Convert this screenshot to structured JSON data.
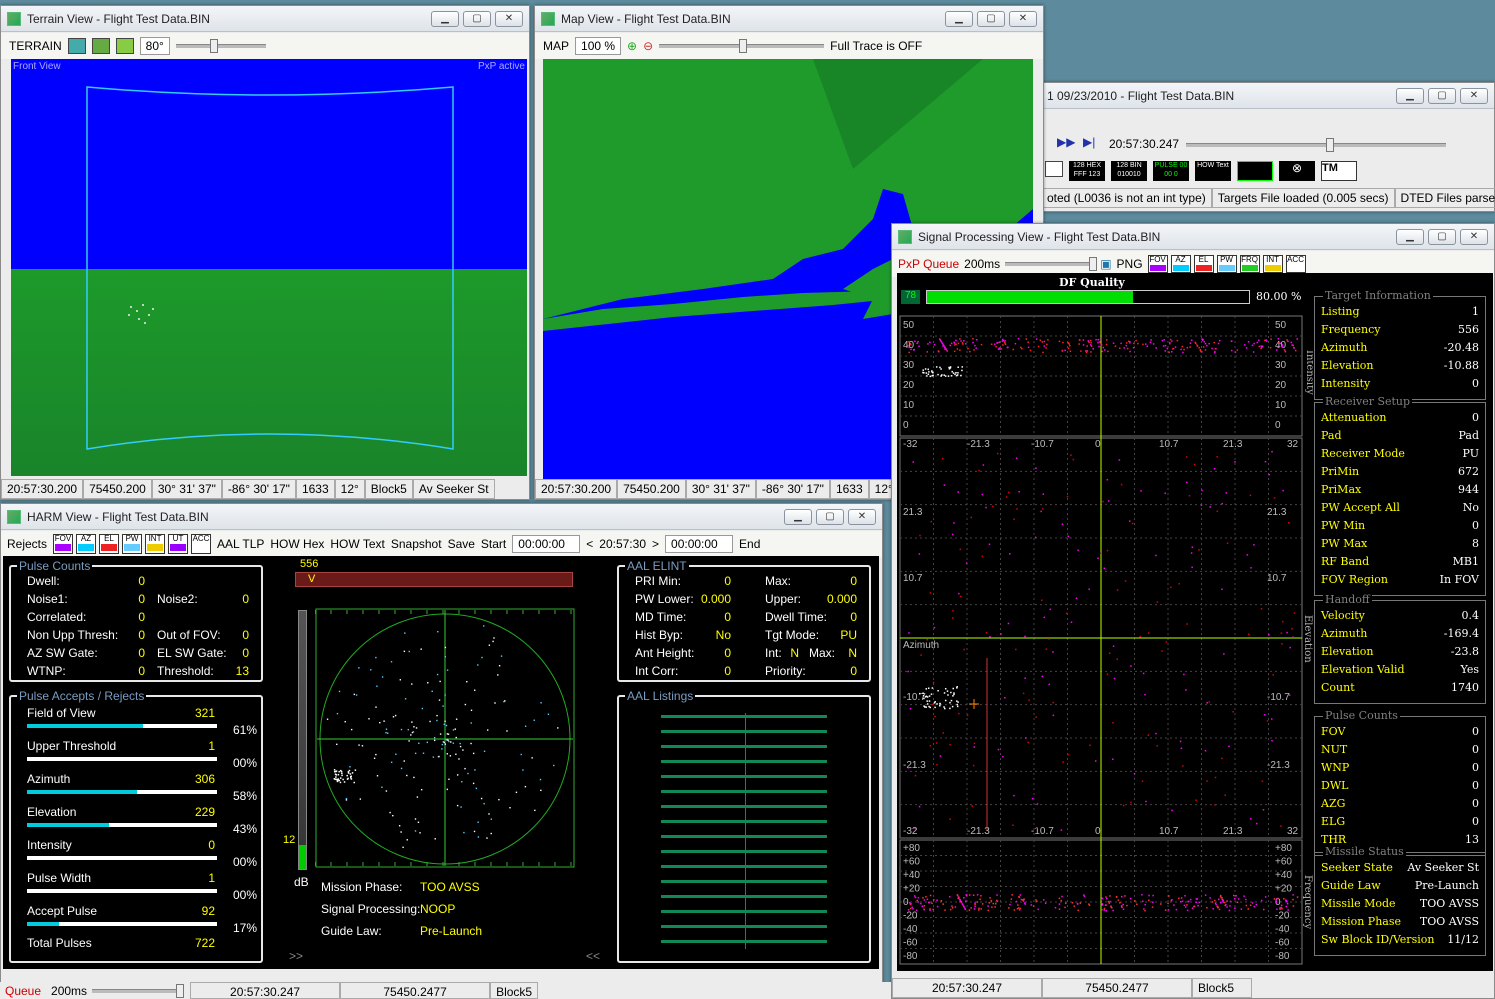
{
  "terrain": {
    "title": "Terrain View - Flight Test Data.BIN",
    "toolbar_label": "TERRAIN",
    "fov": "80°",
    "overlay_left": "Front View",
    "overlay_right": "PxP active",
    "status": [
      "20:57:30.200",
      "75450.200",
      "30° 31' 37\"",
      "-86° 30' 17\"",
      "1633",
      "12°",
      "Block5",
      "Av Seeker St"
    ]
  },
  "map": {
    "title": "Map View - Flight Test Data.BIN",
    "toolbar_label": "MAP",
    "zoom": "100 %",
    "trace": "Full Trace is OFF",
    "status": [
      "20:57:30.200",
      "75450.200",
      "30° 31' 37\"",
      "-86° 30' 17\"",
      "1633",
      "12°"
    ]
  },
  "player": {
    "title": "1 09/23/2010 - Flight Test Data.BIN",
    "time": "20:57:30.247",
    "buttons": [
      "128 HEX FFF 123",
      "128 BIN 010010",
      "PULSE 00 00 0",
      "HOW Text",
      "TM"
    ],
    "status": [
      "oted (L0036 is not an int type)",
      "Targets File loaded (0.005 secs)",
      "DTED Files parsed (..."
    ]
  },
  "signal": {
    "title": "Signal Processing View - Flight Test Data.BIN",
    "queue_label": "PxP Queue",
    "queue_ms": "200ms",
    "png": "PNG",
    "filters": [
      "FOV",
      "AZ",
      "EL",
      "PW",
      "FRQ",
      "INT",
      "ACC"
    ],
    "df_label": "DF Quality",
    "df_value": "78",
    "df_pct": "80.00 %",
    "df_fraction": 0.8,
    "intensity_ticks": [
      "50",
      "40",
      "30",
      "20",
      "10",
      "0"
    ],
    "intensity_label": "Intensity",
    "az_ticks": [
      "-32",
      "-21.3",
      "-10.7",
      "0",
      "10.7",
      "21.3",
      "32"
    ],
    "el_label": "Elevation",
    "az_label": "Azimuth",
    "el_ticks": [
      "21.3",
      "10.7",
      "-10.7",
      "-21.3"
    ],
    "freq_ticks": [
      "+80",
      "+60",
      "+40",
      "+20",
      "0",
      "-20",
      "-40",
      "-60",
      "-80"
    ],
    "freq_label": "Frequency",
    "sections": [
      {
        "title": "Target Information",
        "rows": [
          [
            "Listing",
            "1"
          ],
          [
            "Frequency",
            "556"
          ],
          [
            "Azimuth",
            "-20.48"
          ],
          [
            "Elevation",
            "-10.88"
          ],
          [
            "Intensity",
            "0"
          ]
        ]
      },
      {
        "title": "Receiver Setup",
        "rows": [
          [
            "Attenuation",
            "0"
          ],
          [
            "Pad",
            "Pad"
          ],
          [
            "Receiver Mode",
            "PU"
          ],
          [
            "PriMin",
            "672"
          ],
          [
            "PriMax",
            "944"
          ],
          [
            "PW Accept All",
            "No"
          ],
          [
            "PW Min",
            "0"
          ],
          [
            "PW Max",
            "8"
          ],
          [
            "RF Band",
            "MB1"
          ],
          [
            "FOV Region",
            "In  FOV"
          ]
        ]
      },
      {
        "title": "Handoff",
        "rows": [
          [
            "Velocity",
            "0.4"
          ],
          [
            "Azimuth",
            "-169.4"
          ],
          [
            "Elevation",
            "-23.8"
          ],
          [
            "Elevation Valid",
            "Yes"
          ],
          [
            "Count",
            "1740"
          ]
        ]
      },
      {
        "title": "Pulse Counts",
        "rows": [
          [
            "FOV",
            "0"
          ],
          [
            "NUT",
            "0"
          ],
          [
            "WNP",
            "0"
          ],
          [
            "DWL",
            "0"
          ],
          [
            "AZG",
            "0"
          ],
          [
            "ELG",
            "0"
          ],
          [
            "THR",
            "13"
          ]
        ]
      },
      {
        "title": "Missile Status",
        "rows": [
          [
            "Seeker State",
            "Av Seeker St"
          ],
          [
            "Guide Law",
            "Pre-Launch"
          ],
          [
            "Missile Mode",
            "TOO AVSS"
          ],
          [
            "Mission Phase",
            "TOO AVSS"
          ],
          [
            "Sw Block ID/Version",
            "11/12"
          ]
        ]
      }
    ],
    "status": [
      "20:57:30.247",
      "75450.2477",
      "Block5"
    ]
  },
  "harm": {
    "title": "HARM View - Flight Test Data.BIN",
    "toolbar": {
      "rejects": "Rejects",
      "filters": [
        "FOV",
        "AZ",
        "EL",
        "PW",
        "INT",
        "UT",
        "ACC"
      ],
      "aal_tlp": "AAL TLP",
      "how_hex": "HOW Hex",
      "how_text": "HOW Text",
      "snapshot": "Snapshot",
      "save": "Save",
      "start": "Start",
      "start_time": "00:00:00",
      "lt": "<",
      "cur": "20:57:30",
      "gt": ">",
      "end_time": "00:00:00",
      "end": "End"
    },
    "pulse_counts": {
      "title": "Pulse Counts",
      "rows": [
        {
          "l": "Dwell:",
          "v": "0"
        },
        {
          "l": "Noise1:",
          "v": "0",
          "l2": "Noise2:",
          "v2": "0"
        },
        {
          "l": "Correlated:",
          "v": "0"
        },
        {
          "l": "Non Upp Thresh:",
          "v": "0",
          "l2": "Out of FOV:",
          "v2": "0"
        },
        {
          "l": "AZ SW Gate:",
          "v": "0",
          "l2": "EL SW Gate:",
          "v2": "0"
        },
        {
          "l": "WTNP:",
          "v": "0",
          "l2": "Threshold:",
          "v2": "13"
        }
      ]
    },
    "accepts": {
      "title": "Pulse Accepts / Rejects",
      "rows": [
        {
          "l": "Field of View",
          "v": "321",
          "pct": "61%",
          "f": 0.61
        },
        {
          "l": "Upper Threshold",
          "v": "1",
          "pct": "00%",
          "f": 0.0
        },
        {
          "l": "Azimuth",
          "v": "306",
          "pct": "58%",
          "f": 0.58
        },
        {
          "l": "Elevation",
          "v": "229",
          "pct": "43%",
          "f": 0.43
        },
        {
          "l": "Intensity",
          "v": "0",
          "pct": "00%",
          "f": 0.0
        },
        {
          "l": "Pulse Width",
          "v": "1",
          "pct": "00%",
          "f": 0.0
        },
        {
          "l": "Accept Pulse",
          "v": "92",
          "pct": "17%",
          "f": 0.17
        }
      ],
      "total_label": "Total Pulses",
      "total": "722"
    },
    "freq_value": "556",
    "freq_marker": "V",
    "db_value": "12",
    "db_label": "dB",
    "mission": [
      [
        "Mission Phase:",
        "TOO AVSS"
      ],
      [
        "Signal Processing:",
        "NOOP"
      ],
      [
        "Guide Law:",
        "Pre-Launch"
      ]
    ],
    "elint": {
      "title": "AAL ELINT",
      "rows": [
        [
          "PRI Min:",
          "0",
          "Max:",
          "0"
        ],
        [
          "PW Lower:",
          "0.000",
          "Upper:",
          "0.000"
        ],
        [
          "MD Time:",
          "0",
          "Dwell Time:",
          "0"
        ],
        [
          "Hist Byp:",
          "No",
          "Tgt Mode:",
          "PU"
        ],
        [
          "Ant Height:",
          "0",
          "Int:",
          "N"
        ],
        [
          "Int Corr:",
          "0",
          "Priority:",
          "0"
        ]
      ],
      "int_max_label": "Max:",
      "int_max": "N"
    },
    "listings_title": "AAL Listings",
    "nav_left": ">>",
    "nav_right": "<<"
  },
  "bottom": {
    "queue": "Queue",
    "ms": "200ms",
    "status": [
      "20:57:30.247",
      "75450.2477",
      "Block5"
    ]
  }
}
